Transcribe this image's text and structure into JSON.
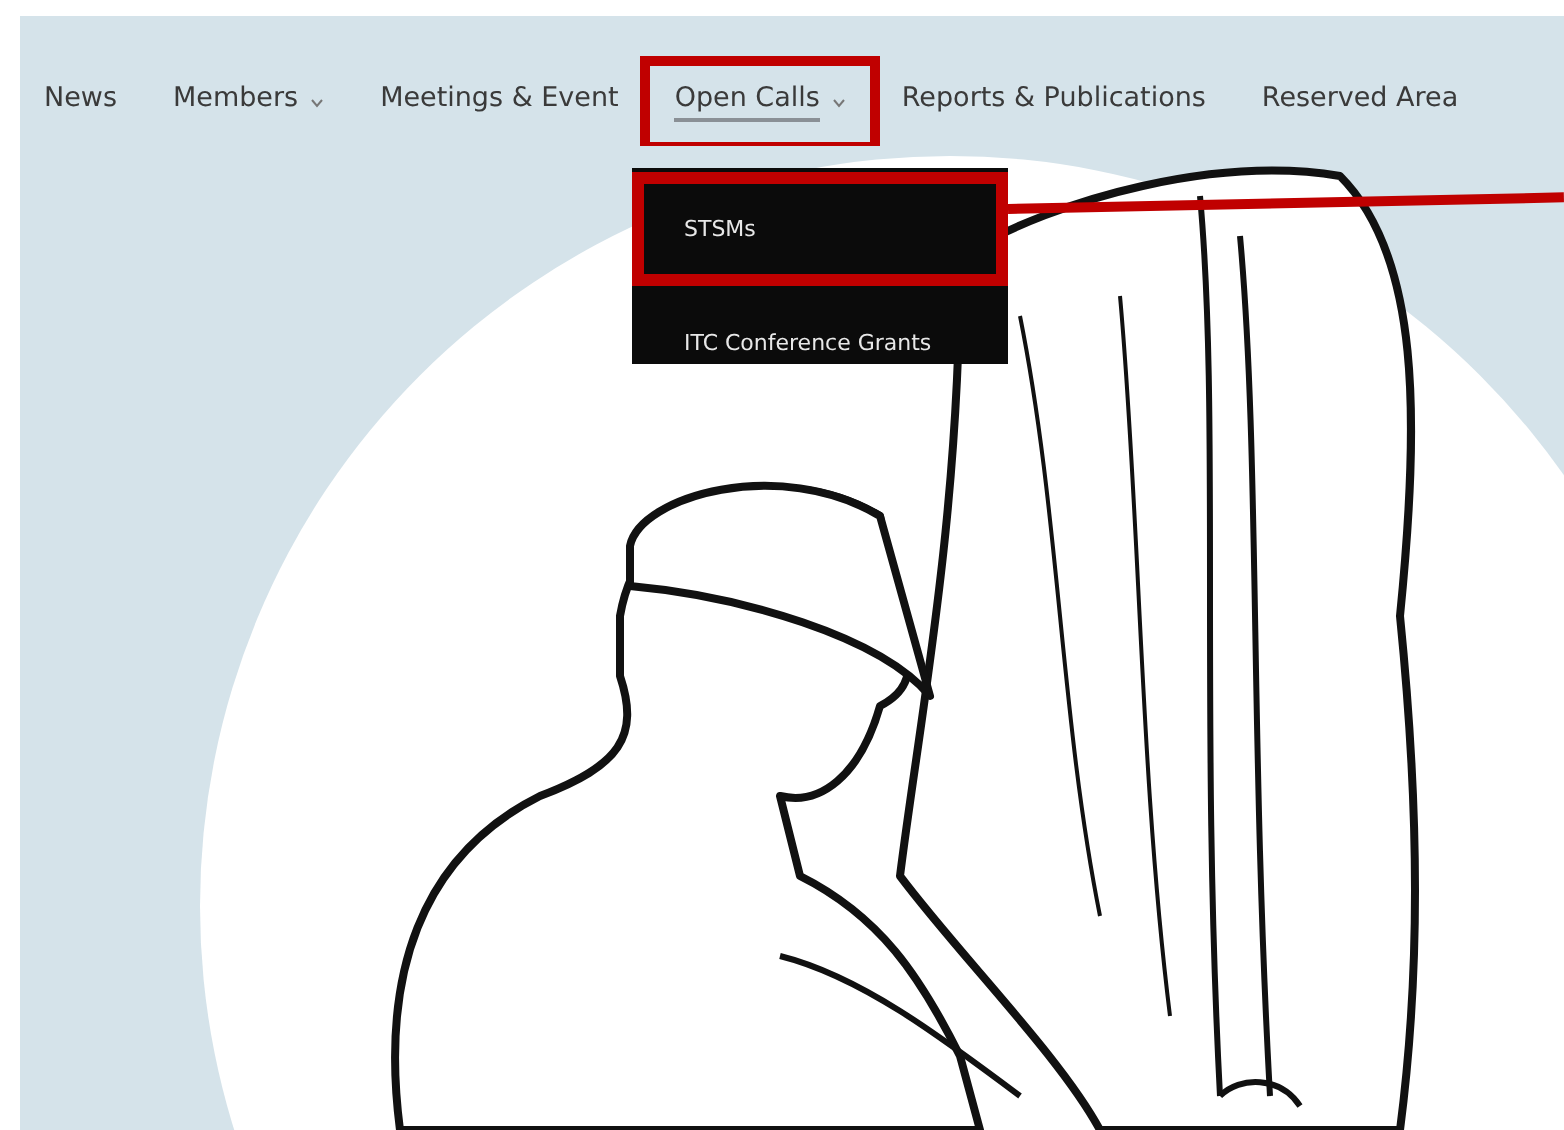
{
  "nav": {
    "items": [
      {
        "label": "News",
        "has_dropdown": false,
        "selected": false,
        "highlighted": false
      },
      {
        "label": "Members",
        "has_dropdown": true,
        "selected": false,
        "highlighted": false
      },
      {
        "label": "Meetings & Event",
        "has_dropdown": false,
        "selected": false,
        "highlighted": false
      },
      {
        "label": "Open Calls",
        "has_dropdown": true,
        "selected": true,
        "highlighted": true
      },
      {
        "label": "Reports & Publications",
        "has_dropdown": false,
        "selected": false,
        "highlighted": false
      },
      {
        "label": "Reserved Area",
        "has_dropdown": false,
        "selected": false,
        "highlighted": false
      }
    ]
  },
  "dropdown": {
    "items": [
      {
        "label": "STSMs",
        "highlighted": true
      },
      {
        "label": "ITC Conference Grants",
        "highlighted": false
      }
    ]
  }
}
